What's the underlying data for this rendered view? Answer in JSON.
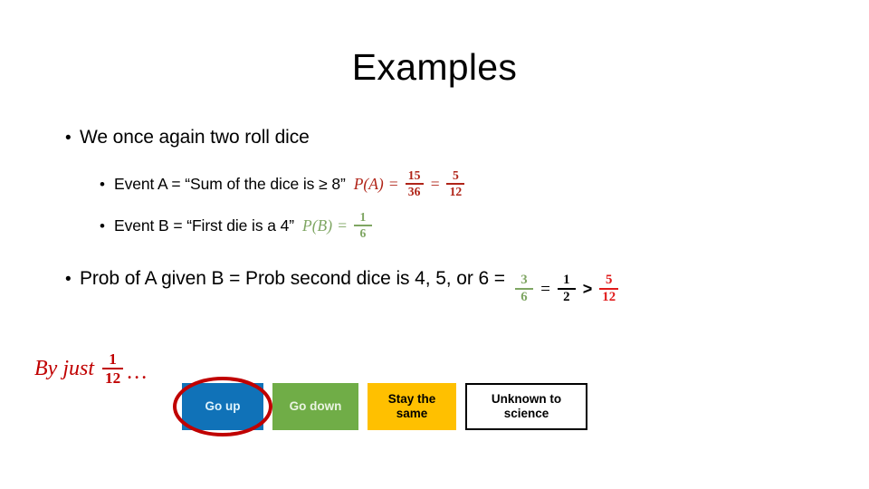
{
  "slide": {
    "title": "Examples"
  },
  "bullets": {
    "b1": {
      "marker": "•",
      "text": "We once again two roll dice"
    },
    "b2": {
      "marker": "•",
      "text": "Event A = “Sum of the dice is ≥ 8”",
      "math": {
        "lhs": "P(A)",
        "eq1": "=",
        "frac1": {
          "num": "15",
          "den": "36",
          "color": "#B02418"
        },
        "eq2": "=",
        "frac2": {
          "num": "5",
          "den": "12",
          "color": "#B02418"
        }
      }
    },
    "b3": {
      "marker": "•",
      "text": "Event B = “First die is a 4”",
      "math": {
        "lhs": "P(B)",
        "eq1": "=",
        "frac1": {
          "num": "1",
          "den": "6",
          "color": "#7FA663"
        }
      }
    },
    "b4": {
      "marker": "•",
      "text": "Prob of A given B = Prob second dice is 4, 5, or 6 =",
      "math": {
        "frac1": {
          "num": "3",
          "den": "6",
          "color": "#7FA663"
        },
        "eq1": "=",
        "frac2": {
          "num": "1",
          "den": "2",
          "color": "#000000"
        },
        "rel": ">",
        "frac3": {
          "num": "5",
          "den": "12",
          "color": "#E01B1B"
        }
      }
    }
  },
  "conclusion": {
    "lead": "By just",
    "frac": {
      "num": "1",
      "den": "12"
    },
    "tail": "…",
    "color": "#C00000"
  },
  "choices": {
    "items": [
      {
        "label": "Go up",
        "bg": "#1072B8",
        "fg": "#DFF3FC",
        "highlighted": true
      },
      {
        "label": "Go down",
        "bg": "#70AD47",
        "fg": "#EAF4E2",
        "highlighted": false
      },
      {
        "label": "Stay the same",
        "bg": "#FFC000",
        "fg": "#000000",
        "highlighted": false
      },
      {
        "label": "Unknown to science",
        "bg": "#FFFFFF",
        "fg": "#000000",
        "highlighted": false
      }
    ],
    "highlight_color": "#C00000"
  }
}
